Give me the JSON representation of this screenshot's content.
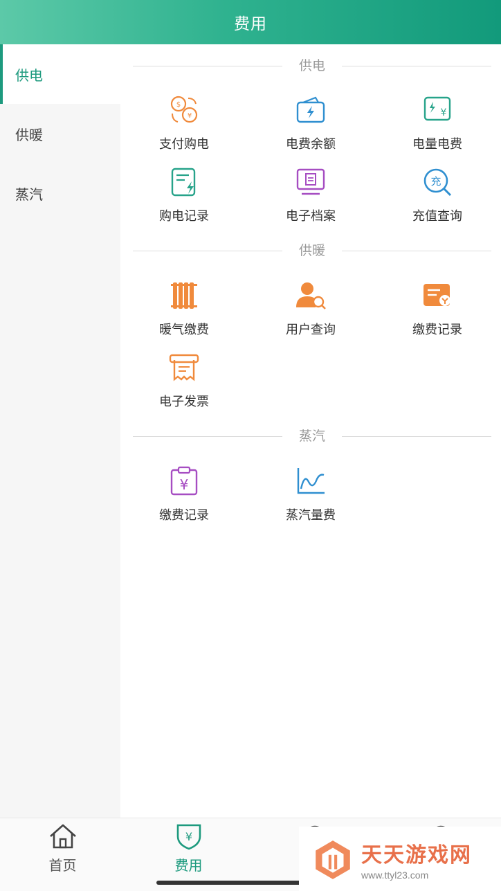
{
  "header": {
    "title": "费用"
  },
  "sidebar": {
    "items": [
      {
        "label": "供电",
        "active": true
      },
      {
        "label": "供暖",
        "active": false
      },
      {
        "label": "蒸汽",
        "active": false
      }
    ]
  },
  "sections": {
    "power": {
      "title": "供电",
      "items": [
        {
          "label": "支付购电",
          "icon": "coin-exchange-icon"
        },
        {
          "label": "电费余额",
          "icon": "wallet-lightning-icon"
        },
        {
          "label": "电量电费",
          "icon": "meter-yen-icon"
        },
        {
          "label": "购电记录",
          "icon": "record-lightning-icon"
        },
        {
          "label": "电子档案",
          "icon": "monitor-document-icon"
        },
        {
          "label": "充值查询",
          "icon": "recharge-search-icon"
        }
      ]
    },
    "heating": {
      "title": "供暖",
      "items": [
        {
          "label": "暖气缴费",
          "icon": "radiator-icon"
        },
        {
          "label": "用户查询",
          "icon": "user-search-icon"
        },
        {
          "label": "缴费记录",
          "icon": "payment-record-icon"
        },
        {
          "label": "电子发票",
          "icon": "receipt-icon"
        }
      ]
    },
    "steam": {
      "title": "蒸汽",
      "items": [
        {
          "label": "缴费记录",
          "icon": "clipboard-yen-icon"
        },
        {
          "label": "蒸汽量费",
          "icon": "line-chart-icon"
        }
      ]
    }
  },
  "tabbar": {
    "items": [
      {
        "label": "首页",
        "icon": "home-icon",
        "active": false
      },
      {
        "label": "费用",
        "icon": "shield-yen-icon",
        "active": true
      }
    ]
  },
  "watermark": {
    "title": "天天游戏网",
    "url": "www.ttyl23.com"
  },
  "colors": {
    "accent": "#1d9a7e",
    "orange": "#f08a3c",
    "blue": "#2f8fd0",
    "teal": "#27a38a",
    "purple": "#a64dc2"
  }
}
